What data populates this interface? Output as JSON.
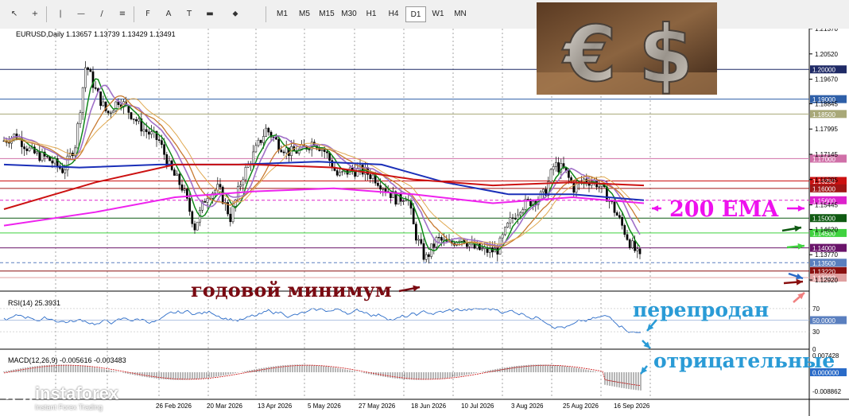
{
  "toolbar": {
    "tools": [
      {
        "name": "cursor-icon",
        "glyph": "↖"
      },
      {
        "name": "crosshair-icon",
        "glyph": "+"
      },
      {
        "name": "vertical-line-icon",
        "glyph": "|"
      },
      {
        "name": "horizontal-line-icon",
        "glyph": "—"
      },
      {
        "name": "trendline-icon",
        "glyph": "/"
      },
      {
        "name": "channel-icon",
        "glyph": "≡"
      },
      {
        "name": "fibonacci-icon",
        "glyph": "F"
      },
      {
        "name": "text-icon",
        "glyph": "A"
      },
      {
        "name": "label-icon",
        "glyph": "T"
      },
      {
        "name": "shapes-icon",
        "glyph": "▬"
      },
      {
        "name": "arrows-icon",
        "glyph": "⬥"
      }
    ],
    "timeframes": [
      "M1",
      "M5",
      "M15",
      "M30",
      "H1",
      "H4",
      "D1",
      "W1",
      "MN"
    ],
    "active_timeframe": "D1"
  },
  "chart_info": "EURUSD,Daily  1.13657 1.13739 1.13429 1.13491",
  "rsi_label": "RSI(14) 25.3931",
  "macd_label": "MACD(12,26,9) -0.005616 -0.003483",
  "price_axis": [
    "1.21370",
    "1.20520",
    "1.19670",
    "1.18845",
    "1.17995",
    "1.17145",
    "1.16295",
    "1.15445",
    "1.14620",
    "1.13770",
    "1.12920"
  ],
  "price_lines": [
    {
      "label": "1.20000",
      "price": 1.2,
      "color": "#1f2a66"
    },
    {
      "label": "1.19000",
      "price": 1.19,
      "color": "#2e5fa8"
    },
    {
      "label": "1.18500",
      "price": 1.185,
      "color": "#a8a878"
    },
    {
      "label": "1.17000",
      "price": 1.17,
      "color": "#d070a8"
    },
    {
      "label": "1.16250",
      "price": 1.1625,
      "color": "#cc1111"
    },
    {
      "label": "1.16000",
      "price": 1.16,
      "color": "#a01616"
    },
    {
      "label": "1.15600",
      "price": 1.156,
      "color": "#dd22cc"
    },
    {
      "label": "1.15000",
      "price": 1.15,
      "color": "#0f5a12"
    },
    {
      "label": "1.14500",
      "price": 1.145,
      "color": "#3fd23f"
    },
    {
      "label": "1.14000",
      "price": 1.14,
      "color": "#6a146a"
    },
    {
      "label": "1.13500",
      "price": 1.135,
      "color": "#5a7fbf"
    },
    {
      "label": "1.13220",
      "price": 1.1322,
      "color": "#8a1010"
    },
    {
      "label": "1.13000",
      "price": 1.13,
      "color": "#e0a0a0"
    }
  ],
  "rsi_axis": [
    "70",
    "30",
    "0"
  ],
  "rsi_level": "50.0000",
  "macd_axis": [
    "0.007428",
    "-0.008862"
  ],
  "macd_zero": "0.000000",
  "dates": [
    "26 Feb 2026",
    "20 Mar 2026",
    "13 Apr 2026",
    "5 May 2026",
    "27 May 2026",
    "18 Jun 2026",
    "10 Jul 2026",
    "3 Aug 2026",
    "25 Aug 2026",
    "16 Sep 2026"
  ],
  "annotations": {
    "ema": "200 EMA",
    "yearly_low": "годовой минимум",
    "oversold": "перепродан",
    "negative": "отрицательные"
  },
  "logo": {
    "brand": "instaforex",
    "tagline": "Instant Forex Trading"
  },
  "colors": {
    "ema200": "#cc1111",
    "sma_long": "#1a2fb8",
    "ema_pink": "#ee22ee",
    "ma_orange": "#c87a30",
    "ma_tan": "#e0a850",
    "ma_purple": "#a070c8",
    "ma_green": "#11871a",
    "ma_lightgreen": "#80dd80",
    "rsi": "#2a6bc8",
    "macd_hist": "#6c6c6c",
    "macd_signal": "#cc2222",
    "annotation_dark": "#7a0a12",
    "annotation_magenta": "#ee11ee",
    "annotation_blue": "#2a9bd6"
  }
}
